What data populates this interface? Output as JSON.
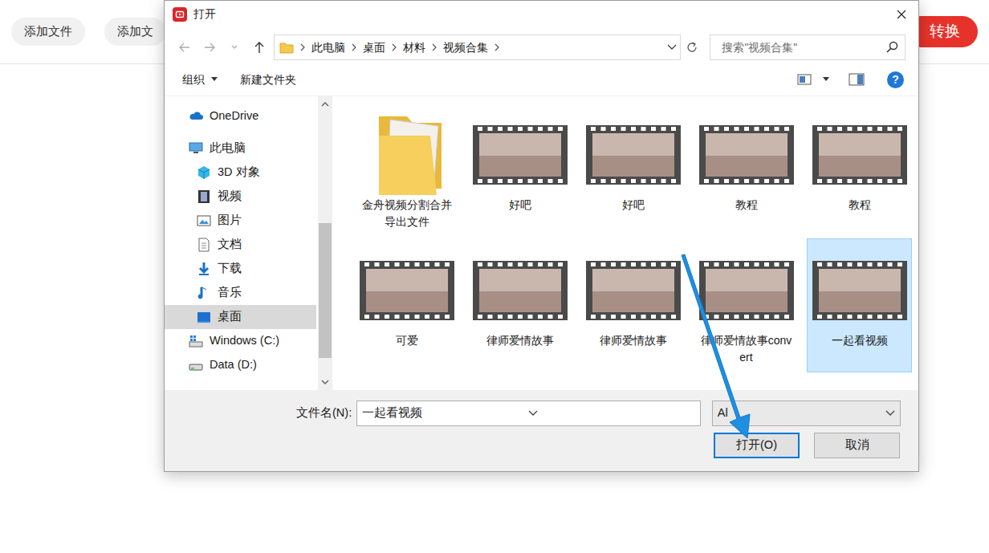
{
  "app": {
    "buttons": [
      "添加文件",
      "添加文"
    ],
    "convert": "转换"
  },
  "window": {
    "title": "打开"
  },
  "breadcrumb": [
    "此电脑",
    "桌面",
    "材料",
    "视频合集"
  ],
  "search": {
    "placeholder": "搜索\"视频合集\""
  },
  "toolbar": {
    "organize": "组织",
    "new_folder": "新建文件夹",
    "help": "?"
  },
  "sidebar": {
    "items": [
      {
        "label": "OneDrive",
        "kind": "cloud",
        "selected": false
      },
      {
        "label": "此电脑",
        "kind": "pc",
        "selected": false
      },
      {
        "label": "3D 对象",
        "kind": "cube",
        "selected": false
      },
      {
        "label": "视频",
        "kind": "video",
        "selected": false
      },
      {
        "label": "图片",
        "kind": "picture",
        "selected": false
      },
      {
        "label": "文档",
        "kind": "document",
        "selected": false
      },
      {
        "label": "下载",
        "kind": "download",
        "selected": false
      },
      {
        "label": "音乐",
        "kind": "music",
        "selected": false
      },
      {
        "label": "桌面",
        "kind": "desktop",
        "selected": true
      },
      {
        "label": "Windows (C:)",
        "kind": "system-drive",
        "selected": false
      },
      {
        "label": "Data (D:)",
        "kind": "drive",
        "selected": false
      }
    ]
  },
  "files": [
    {
      "name": "金舟视频分割合并导出文件",
      "kind": "folder",
      "selected": false
    },
    {
      "name": "好吧",
      "kind": "video",
      "selected": false
    },
    {
      "name": "好吧",
      "kind": "video",
      "selected": false
    },
    {
      "name": "教程",
      "kind": "video",
      "selected": false
    },
    {
      "name": "教程",
      "kind": "video",
      "selected": false
    },
    {
      "name": "可爱",
      "kind": "video",
      "selected": false
    },
    {
      "name": "律师爱情故事",
      "kind": "video",
      "selected": false
    },
    {
      "name": "律师爱情故事",
      "kind": "video",
      "selected": false
    },
    {
      "name": "律师爱情故事convert",
      "kind": "video",
      "selected": false
    },
    {
      "name": "一起看视频",
      "kind": "video",
      "selected": true
    }
  ],
  "filename": {
    "label": "文件名(N):",
    "value": "一起看视频"
  },
  "filter": {
    "value": "Al"
  },
  "buttons": [
    {
      "label": "打开(O)",
      "focused": true
    },
    {
      "label": "取消",
      "focused": false
    }
  ]
}
